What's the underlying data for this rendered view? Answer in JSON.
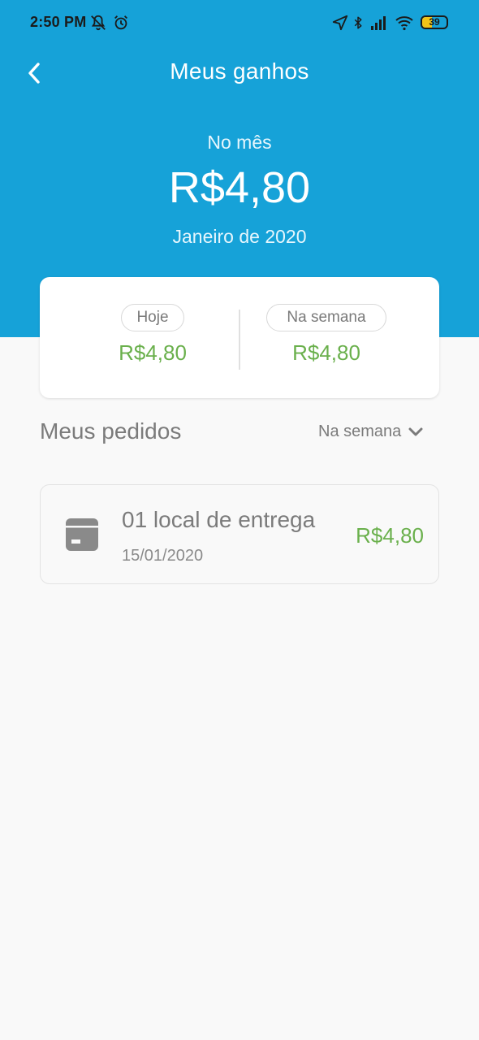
{
  "status_bar": {
    "time": "2:50 PM",
    "battery": "39"
  },
  "header": {
    "title": "Meus ganhos",
    "back_icon": "chevron-left-icon"
  },
  "month_summary": {
    "label": "No mês",
    "value": "R$4,80",
    "period": "Janeiro de 2020"
  },
  "summary_card": {
    "today": {
      "label": "Hoje",
      "value": "R$4,80"
    },
    "week": {
      "label": "Na semana",
      "value": "R$4,80"
    }
  },
  "orders_section": {
    "title": "Meus pedidos",
    "filter": "Na semana",
    "filter_icon": "chevron-down-icon"
  },
  "orders": [
    {
      "title": "01 local de entrega",
      "date": "15/01/2020",
      "value": "R$4,80",
      "icon": "box-icon"
    }
  ],
  "colors": {
    "header": "#16a2d8",
    "money": "#6ab04c",
    "background": "#f9f9f9"
  }
}
